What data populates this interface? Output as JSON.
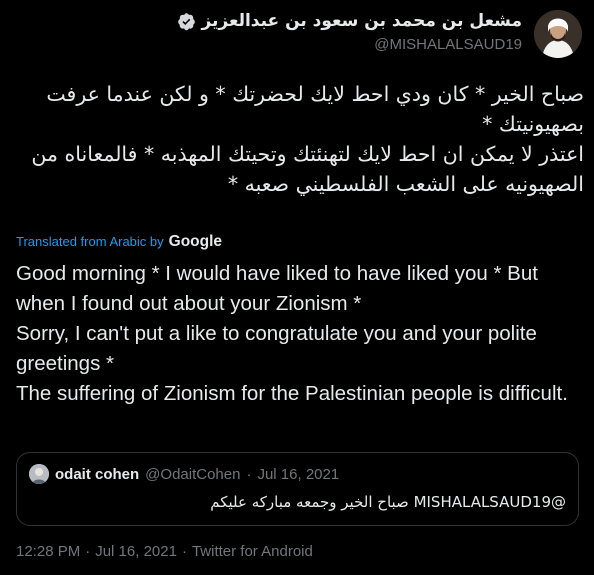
{
  "author": {
    "display_name": "مشعل بن محمد بن سعود بن عبدالعزيز",
    "handle": "@MISHALALSAUD19",
    "verified": true,
    "avatar_icon": "profile-avatar"
  },
  "more_icon": "more-horizontal-icon",
  "tweet": {
    "original_text": "صباح الخير * كان ودي احط لايك لحضرتك * و لكن عندما عرفت بصهيونيتك *\nاعتذر لا يمكن ان احط لايك لتهنئتك وتحيتك المهذبه * فالمعاناه من الصهيونيه على الشعب الفلسطيني صعبه *",
    "translated_label": "Translated from Arabic by",
    "translator": "Google",
    "translated_text": "Good morning * I would have liked to have liked you * But when I found out about your Zionism *\nSorry, I can't put a like to congratulate you and your polite greetings *\nThe suffering of Zionism for the Palestinian people is difficult."
  },
  "quoted": {
    "name": "odait cohen",
    "handle": "@OdaitCohen",
    "separator": "·",
    "date": "Jul 16, 2021",
    "text": "@MISHALALSAUD19 صباح الخير وجمعه مباركه عليكم"
  },
  "meta": {
    "time": "12:28 PM",
    "sep1": "·",
    "date": "Jul 16, 2021",
    "sep2": "·",
    "source": "Twitter for Android"
  },
  "colors": {
    "background": "#000000",
    "text": "#e7e9ea",
    "secondary": "#71767b",
    "accent": "#1d9bf0",
    "border": "#2f3336"
  }
}
